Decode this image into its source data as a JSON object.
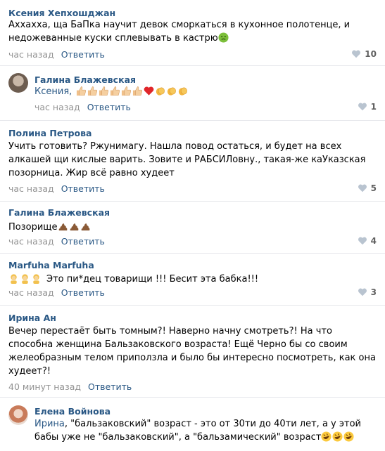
{
  "comments": [
    {
      "author": "Ксения Хепхошджан",
      "lines": [
        "Аххахха, ща БаПка научит девок сморкаться в кухонное полотенце, и",
        "недожеванные куски сплевывать в кастрю"
      ],
      "time": "час назад",
      "reply": "Ответить",
      "likes": "10",
      "emoji": [
        "nauseated-face"
      ]
    },
    {
      "author": "Галина Блажевская",
      "mention": "Ксения,",
      "time": "час назад",
      "reply": "Ответить",
      "likes": "1",
      "emoji": [
        "thumbs-up",
        "thumbs-up",
        "thumbs-up",
        "thumbs-up",
        "thumbs-up",
        "thumbs-up",
        "red-heart",
        "clapping-hands",
        "clapping-hands",
        "clapping-hands"
      ]
    },
    {
      "author": "Полина Петрова",
      "lines": [
        "Учить готовить? Ржунимагу. Нашла повод остаться, и будет на всех",
        "алкашей щи кислые варить. Зовите и РАБСИЛовну., такая-же каУказская",
        "позорница. Жир всё равно худеет"
      ],
      "time": "час назад",
      "reply": "Ответить",
      "likes": "5"
    },
    {
      "author": "Галина Блажевская",
      "lines": [
        "Позорище"
      ],
      "time": "час назад",
      "reply": "Ответить",
      "likes": "4",
      "emoji": [
        "pile-of-poo",
        "pile-of-poo",
        "pile-of-poo"
      ]
    },
    {
      "author": "Marfuha Marfuha",
      "lines": [
        "Это пи*дец товарищи !!! Бесит эта бабка!!!"
      ],
      "time": "час назад",
      "reply": "Ответить",
      "likes": "3",
      "emoji": [
        "person-blond",
        "person-blond",
        "person-blond"
      ]
    },
    {
      "author": "Ирина Ан",
      "lines": [
        "Вечер перестаёт быть томным?! Наверно начну смотреть?! На что",
        "способна женщина Бальзаковского возраста! Ещё Черно бы со своим",
        "желеобразным телом приползла и было бы интересно посмотреть, как она",
        "худеет?!"
      ],
      "time": "40 минут назад",
      "reply": "Ответить"
    },
    {
      "author": "Елена Войнова",
      "mention": "Ирина",
      "lines": [
        ", \"бальзаковский\" возраст - это от 30ти до 40ти лет, а у этой",
        "бабы уже не \"бальзаковский\", а \"бальзамический\" возраст"
      ],
      "emoji": [
        "rolling-laughing",
        "rolling-laughing",
        "rolling-laughing"
      ]
    }
  ],
  "colors": {
    "link": "#2a5885",
    "meta": "#939393",
    "divider": "#e7e8ec"
  }
}
